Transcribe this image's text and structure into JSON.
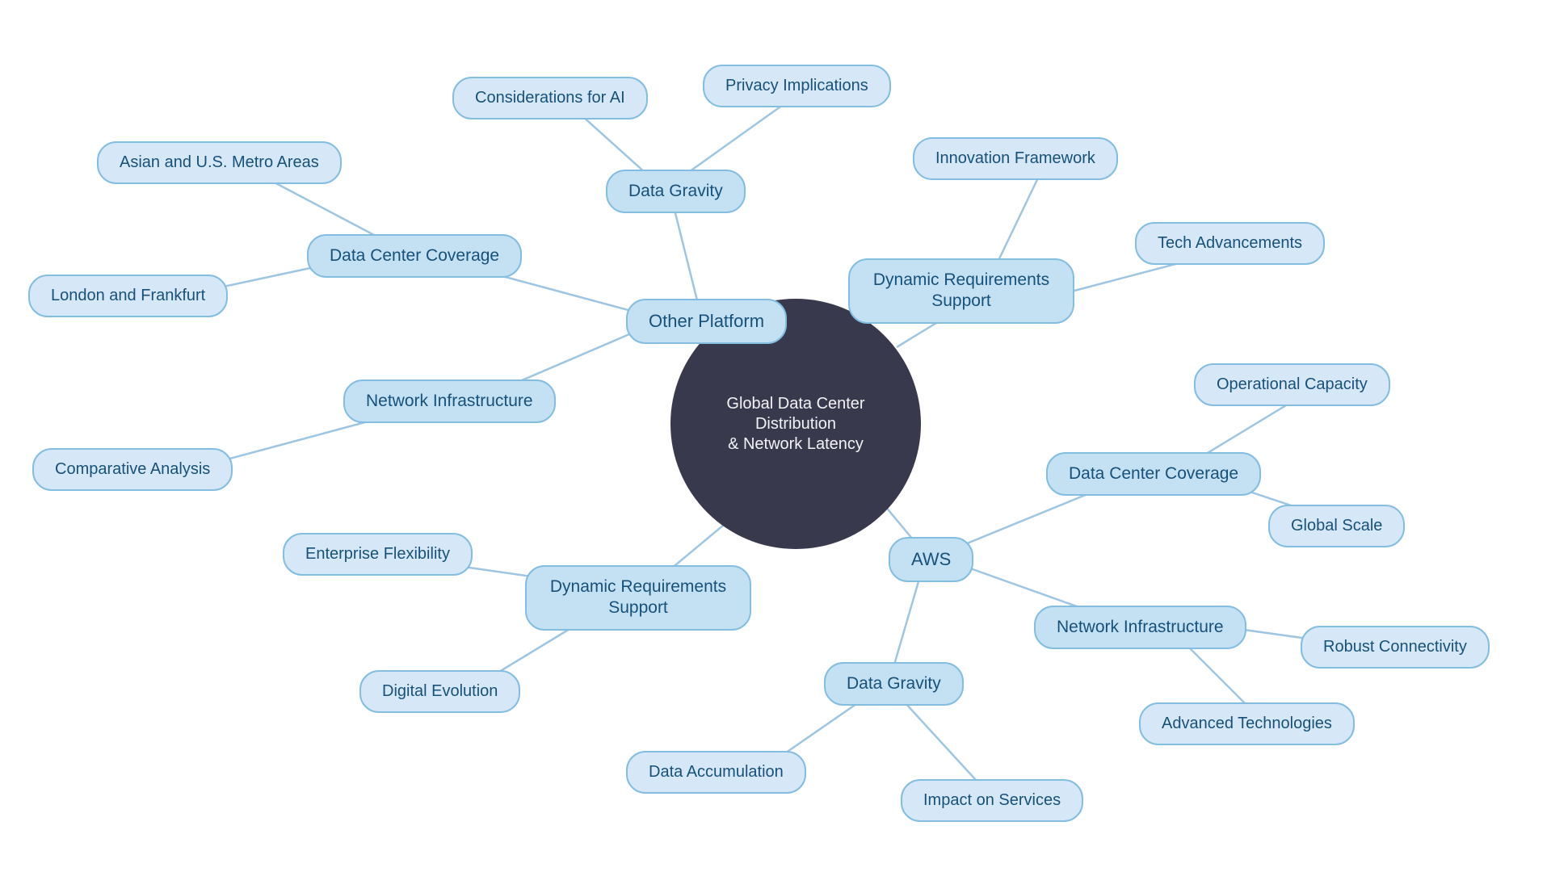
{
  "center": {
    "label": "Global Data Center Distribution\n& Network Latency"
  },
  "other": {
    "label": "Other Platform",
    "dcc": {
      "label": "Data Center Coverage",
      "asia": {
        "label": "Asian and U.S. Metro Areas"
      },
      "london": {
        "label": "London and Frankfurt"
      }
    },
    "net": {
      "label": "Network Infrastructure",
      "comp": {
        "label": "Comparative Analysis"
      }
    },
    "grav": {
      "label": "Data Gravity",
      "ai": {
        "label": "Considerations for AI"
      },
      "priv": {
        "label": "Privacy Implications"
      }
    },
    "dyn": {
      "label": "Dynamic Requirements\nSupport",
      "flex": {
        "label": "Enterprise Flexibility"
      },
      "evo": {
        "label": "Digital Evolution"
      }
    }
  },
  "aws": {
    "label": "AWS",
    "dcc": {
      "label": "Data Center Coverage",
      "op": {
        "label": "Operational Capacity"
      },
      "scale": {
        "label": "Global Scale"
      }
    },
    "net": {
      "label": "Network Infrastructure",
      "robust": {
        "label": "Robust Connectivity"
      },
      "adv": {
        "label": "Advanced Technologies"
      }
    },
    "grav": {
      "label": "Data Gravity",
      "accum": {
        "label": "Data Accumulation"
      },
      "impact": {
        "label": "Impact on Services"
      }
    },
    "dyn": {
      "label": "Dynamic Requirements\nSupport",
      "innov": {
        "label": "Innovation Framework"
      },
      "tech": {
        "label": "Tech Advancements"
      }
    }
  },
  "colors": {
    "edge": "#9ec6e3",
    "center_bg": "#39394e"
  }
}
